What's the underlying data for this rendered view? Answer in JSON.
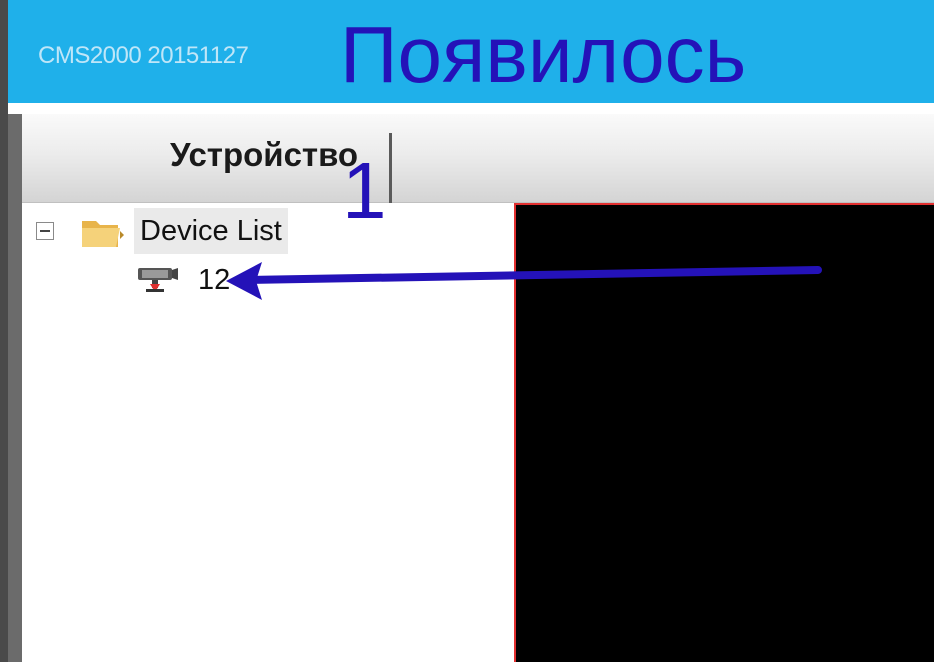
{
  "window": {
    "app_title": "CMS2000 20151127"
  },
  "annotations": {
    "title_text": "Появилось",
    "step_number": "1",
    "arrow_color": "#2412b8"
  },
  "tabs": {
    "device_tab_label": "Устройство"
  },
  "device_tree": {
    "root_label": "Device List",
    "expander_state": "expanded",
    "root_icon": "folder-icon",
    "children": [
      {
        "label": "12",
        "icon": "camera-icon"
      }
    ]
  },
  "video": {
    "background": "#000000",
    "border_color": "#e23030"
  },
  "colors": {
    "title_bar": "#1fb0ea",
    "app_title_text": "#bfe6f8",
    "annotation": "#2412b8"
  }
}
